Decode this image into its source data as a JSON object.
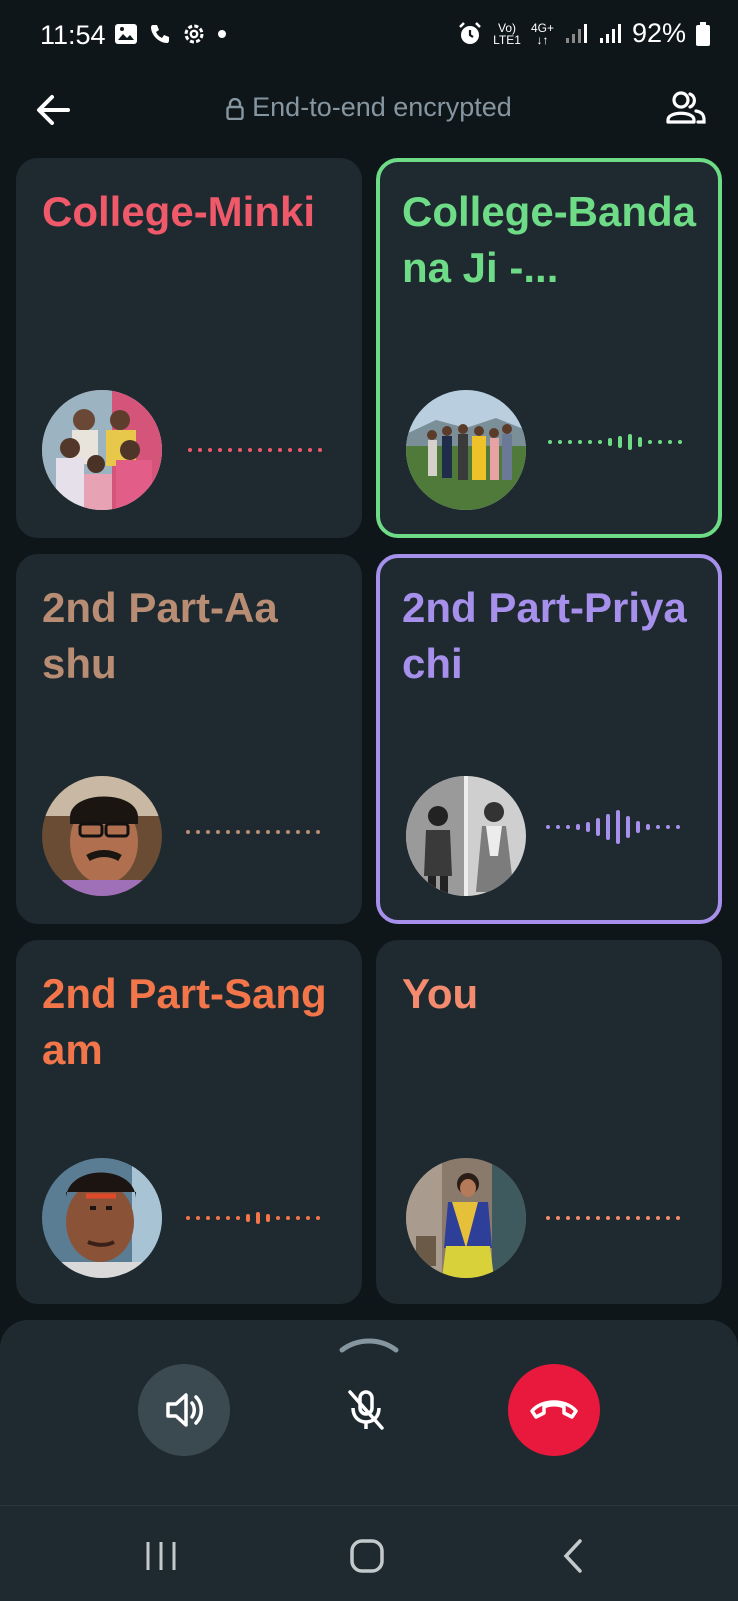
{
  "status_bar": {
    "time": "11:54",
    "network_top": "Vo)",
    "network_bottom": "LTE1",
    "data_top": "4G+",
    "data_bottom": "↓↑",
    "battery": "92%"
  },
  "header": {
    "encryption_label": "End-to-end encrypted"
  },
  "participants": [
    {
      "name": "College-Minki",
      "color": "#f0596a",
      "speaking": false
    },
    {
      "name": "College-Bandana Ji -...",
      "color": "#6edb86",
      "speaking": true
    },
    {
      "name": "2nd Part-Aashu",
      "color": "#b88d74",
      "speaking": false
    },
    {
      "name": "2nd Part-Priyachi",
      "color": "#a790ec",
      "speaking": true
    },
    {
      "name": "2nd Part-Sangam",
      "color": "#f3764a",
      "speaking": false
    },
    {
      "name": "You",
      "color": "#f48b6e",
      "speaking": false
    }
  ],
  "icons": {
    "back": "back-arrow-icon",
    "lock": "lock-icon",
    "participants": "people-icon",
    "speaker": "speaker-icon",
    "mute": "mic-off-icon",
    "end_call": "end-call-icon"
  },
  "colors": {
    "end_call": "#e8193c",
    "tile_bg": "#1f2a30"
  }
}
